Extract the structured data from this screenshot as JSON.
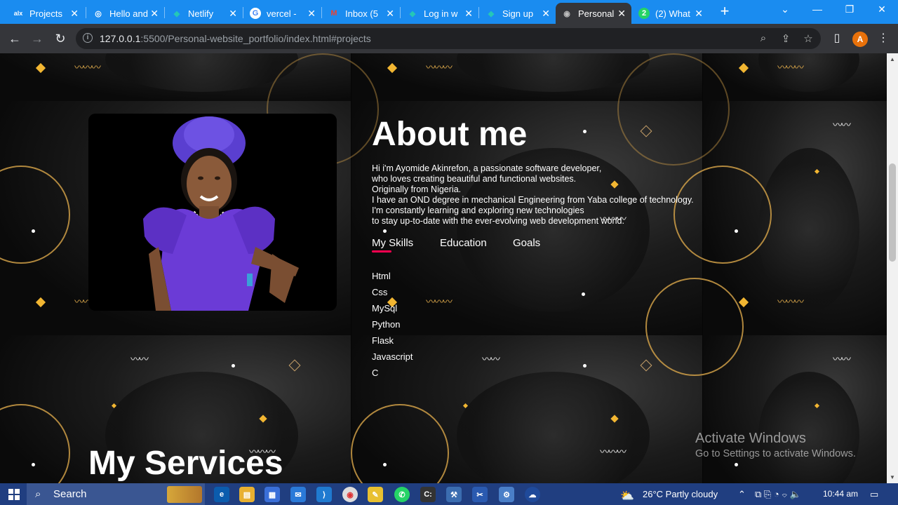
{
  "browser": {
    "tabs": [
      {
        "title": "Projects",
        "favicon": "alx-icon",
        "fav_text": "alx"
      },
      {
        "title": "Hello and",
        "favicon": "globe-icon",
        "fav_text": "◎"
      },
      {
        "title": "Netlify",
        "favicon": "netlify-icon",
        "fav_text": "◆"
      },
      {
        "title": "vercel -",
        "favicon": "google-icon",
        "fav_text": "G"
      },
      {
        "title": "Inbox (5",
        "favicon": "gmail-icon",
        "fav_text": "M"
      },
      {
        "title": "Log in w",
        "favicon": "netlify-icon",
        "fav_text": "◆"
      },
      {
        "title": "Sign up",
        "favicon": "netlify-icon",
        "fav_text": "◆"
      },
      {
        "title": "Personal",
        "favicon": "globe-icon",
        "fav_text": "◉",
        "active": true
      },
      {
        "title": "(2) What",
        "favicon": "whatsapp-icon",
        "fav_text": "2"
      }
    ],
    "url_host": "127.0.0.1",
    "url_rest": ":5500/Personal-website_portfolio/index.html#projects",
    "profile_initial": "A"
  },
  "about": {
    "title": "About me",
    "lines": [
      "Hi i'm Ayomide Akinrefon, a passionate software developer,",
      "who loves creating beautiful and functional websites.",
      "Originally from Nigeria.",
      "I have an OND degree in mechanical Engineering from Yaba college of technology.",
      "I'm constantly learning and exploring new technologies",
      "to stay up-to-date with the ever-evolving web development world."
    ],
    "tabs": [
      "My Skills",
      "Education",
      "Goals"
    ],
    "skills": [
      "Html",
      "Css",
      "MySql",
      "Python",
      "Flask",
      "Javascript",
      "C"
    ]
  },
  "services": {
    "title": "My Services"
  },
  "watermark": {
    "line1": "Activate Windows",
    "line2": "Go to Settings to activate Windows."
  },
  "taskbar": {
    "search_label": "Search",
    "weather": "26°C  Partly cloudy",
    "time": "10:44 am"
  },
  "colors": {
    "accent": "#ff004f",
    "gold": "#f2b632",
    "dress": "#6b3bd6"
  }
}
